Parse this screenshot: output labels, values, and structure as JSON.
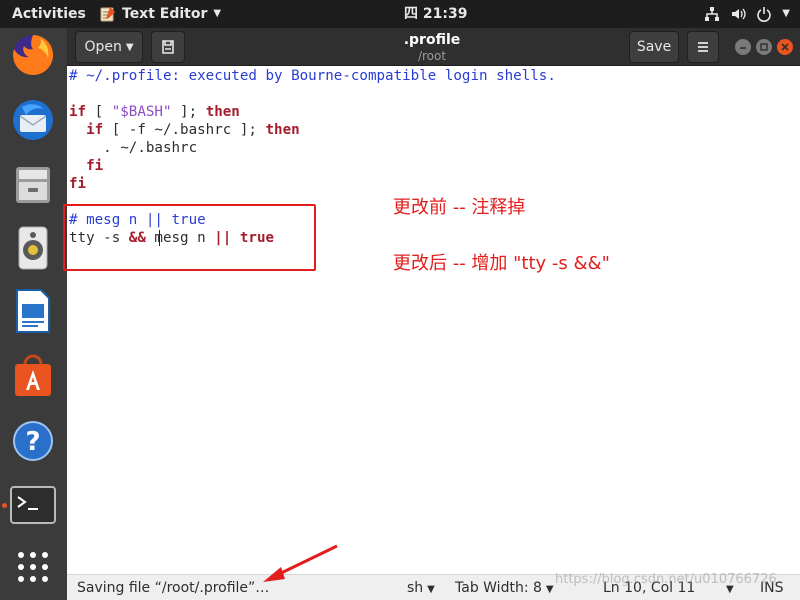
{
  "topbar": {
    "activities": "Activities",
    "app_name": "Text Editor",
    "clock": "四 21:39"
  },
  "window": {
    "title": ".profile",
    "subtitle": "/root",
    "open_label": "Open",
    "save_label": "Save"
  },
  "editor": {
    "lines": [
      "# ~/.profile: executed by Bourne-compatible login shells.",
      "",
      "if [ \"$BASH\" ]; then",
      "  if [ -f ~/.bashrc ]; then",
      "    . ~/.bashrc",
      "  fi",
      "fi",
      "",
      "# mesg n || true",
      "tty -s && mesg n || true"
    ],
    "tokens": {
      "l1": "# ~/.profile: executed by Bourne-compatible login shells.",
      "l3_if": "if",
      "l3_b1": " [ ",
      "l3_str": "\"$BASH\"",
      "l3_b2": " ]; ",
      "l3_then": "then",
      "l4_pre": "  ",
      "l4_if": "if",
      "l4_mid": " [ -f ~/.bashrc ]; ",
      "l4_then": "then",
      "l5": "    . ~/.bashrc",
      "l6_pre": "  ",
      "l6_fi": "fi",
      "l7_fi": "fi",
      "l9": "# mesg n || true",
      "l10_a": "tty -s ",
      "l10_and": "&&",
      "l10_b": " mesg n ",
      "l10_or": "||",
      "l10_c": " ",
      "l10_true": "true"
    }
  },
  "annotations": {
    "before": "更改前 -- 注释掉",
    "after": "更改后 -- 增加 \"tty -s &&\""
  },
  "statusbar": {
    "status": "Saving file “/root/.profile”…",
    "language": "sh",
    "tab_width": "Tab Width: 8",
    "position": "Ln 10, Col 11",
    "mode": "INS"
  },
  "watermark": "https://blog.csdn.net/u010766726",
  "colors": {
    "accent": "#e95420",
    "annotation": "#e31c1c",
    "keyword": "#a51d2d",
    "comment": "#2a3cd3",
    "string": "#8b4ec4"
  }
}
